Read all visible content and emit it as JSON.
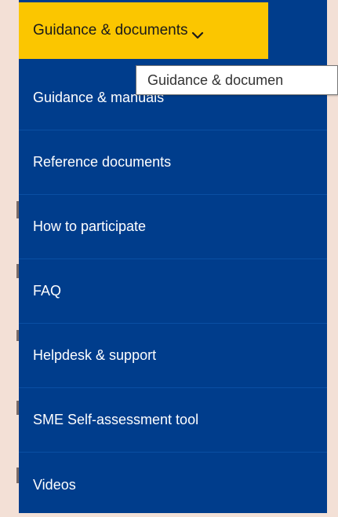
{
  "nav": {
    "top_tab_label": "Guidance & documents",
    "items": [
      {
        "label": "Guidance & manuals"
      },
      {
        "label": "Reference documents"
      },
      {
        "label": "How to participate"
      },
      {
        "label": "FAQ"
      },
      {
        "label": "Helpdesk & support"
      },
      {
        "label": "SME Self-assessment tool"
      },
      {
        "label": "Videos"
      }
    ]
  },
  "tooltip": {
    "text": "Guidance & documen"
  },
  "colors": {
    "menu_bg": "#003d8c",
    "active_tab_bg": "#fbc600",
    "page_bg": "#f3e0d6"
  }
}
